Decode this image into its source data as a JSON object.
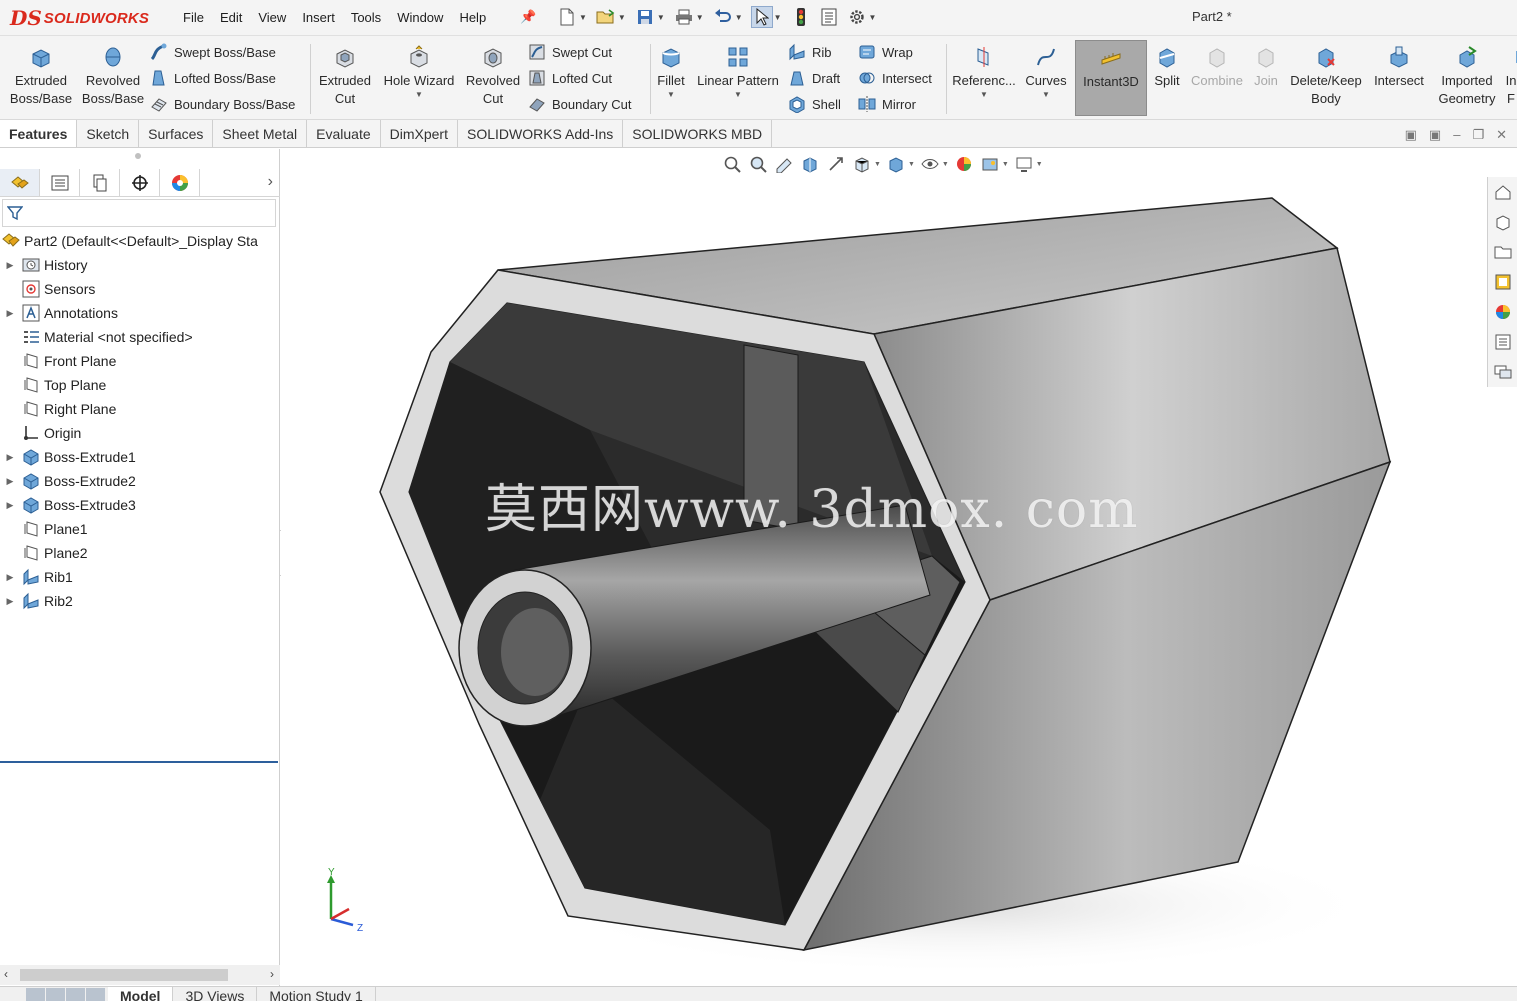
{
  "app": {
    "logo_text": "SOLIDWORKS",
    "logo_prefix": "DS",
    "document_title": "Part2 *"
  },
  "menu": [
    "File",
    "Edit",
    "View",
    "Insert",
    "Tools",
    "Window",
    "Help"
  ],
  "ribbon": {
    "extruded_boss": "Extruded\nBoss/Base",
    "revolved_boss": "Revolved\nBoss/Base",
    "swept_boss": "Swept Boss/Base",
    "lofted_boss": "Lofted Boss/Base",
    "boundary_boss": "Boundary Boss/Base",
    "extruded_cut": "Extruded\nCut",
    "hole_wizard": "Hole Wizard",
    "revolved_cut": "Revolved\nCut",
    "swept_cut": "Swept Cut",
    "lofted_cut": "Lofted Cut",
    "boundary_cut": "Boundary Cut",
    "fillet": "Fillet",
    "linear_pattern": "Linear Pattern",
    "rib": "Rib",
    "draft": "Draft",
    "shell": "Shell",
    "wrap": "Wrap",
    "intersect_small": "Intersect",
    "mirror": "Mirror",
    "reference": "Referenc...",
    "curves": "Curves",
    "instant3d": "Instant3D",
    "split": "Split",
    "combine": "Combine",
    "join": "Join",
    "delete_keep": "Delete/Keep\nBody",
    "intersect_big": "Intersect",
    "imported_geometry": "Imported\nGeometry",
    "overflow_partial": "In\nF"
  },
  "tabs": [
    "Features",
    "Sketch",
    "Surfaces",
    "Sheet Metal",
    "Evaluate",
    "DimXpert",
    "SOLIDWORKS Add-Ins",
    "SOLIDWORKS MBD"
  ],
  "tree": {
    "root": "Part2  (Default<<Default>_Display Sta",
    "items": [
      {
        "label": "History",
        "icon": "history-folder-icon",
        "expandable": true
      },
      {
        "label": "Sensors",
        "icon": "sensor-icon",
        "expandable": false
      },
      {
        "label": "Annotations",
        "icon": "annotation-icon",
        "expandable": true
      },
      {
        "label": "Material <not specified>",
        "icon": "material-icon",
        "expandable": false
      },
      {
        "label": "Front Plane",
        "icon": "plane-icon",
        "expandable": false
      },
      {
        "label": "Top Plane",
        "icon": "plane-icon",
        "expandable": false
      },
      {
        "label": "Right Plane",
        "icon": "plane-icon",
        "expandable": false
      },
      {
        "label": "Origin",
        "icon": "origin-icon",
        "expandable": false
      },
      {
        "label": "Boss-Extrude1",
        "icon": "extrude-icon",
        "expandable": true
      },
      {
        "label": "Boss-Extrude2",
        "icon": "extrude-icon",
        "expandable": true
      },
      {
        "label": "Boss-Extrude3",
        "icon": "extrude-icon",
        "expandable": true
      },
      {
        "label": "Plane1",
        "icon": "plane-icon",
        "expandable": false
      },
      {
        "label": "Plane2",
        "icon": "plane-icon",
        "expandable": false
      },
      {
        "label": "Rib1",
        "icon": "rib-icon",
        "expandable": true
      },
      {
        "label": "Rib2",
        "icon": "rib-icon",
        "expandable": true
      }
    ]
  },
  "bottom_tabs": [
    "Model",
    "3D Views",
    "Motion Study 1"
  ],
  "viewport": {
    "watermark": "莫西网www. 3dmox. com",
    "triad_y": "Y",
    "triad_z": "Z"
  },
  "colors": {
    "brand_red": "#da291c",
    "accent_blue": "#2d5f9c",
    "active_button": "#a9a9a9"
  }
}
